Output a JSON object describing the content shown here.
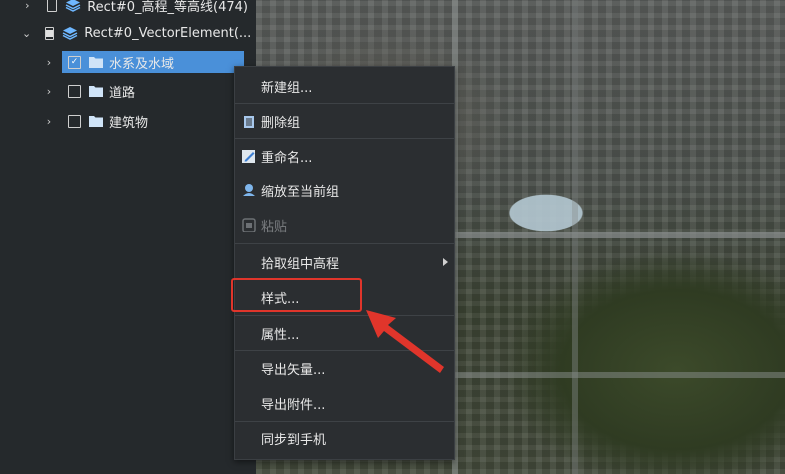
{
  "tree": {
    "items": [
      {
        "label": "Rect#0_高程_等高线(474)",
        "expanded": false,
        "checked": "unchecked",
        "icon": "layers-icon"
      },
      {
        "label": "Rect#0_VectorElement(...",
        "expanded": true,
        "checked": "partial",
        "icon": "layers-icon"
      },
      {
        "label": "水系及水域",
        "expanded": false,
        "checked": "checked",
        "icon": "folder-icon",
        "selected": true
      },
      {
        "label": "道路",
        "expanded": false,
        "checked": "unchecked",
        "icon": "folder-icon"
      },
      {
        "label": "建筑物",
        "expanded": false,
        "checked": "unchecked",
        "icon": "folder-icon"
      }
    ]
  },
  "context_menu": {
    "items": [
      {
        "label": "新建组...",
        "icon": "",
        "disabled": false
      },
      {
        "label": "删除组",
        "icon": "trash-icon",
        "disabled": false
      },
      {
        "label": "重命名...",
        "icon": "pencil-icon",
        "disabled": false
      },
      {
        "label": "缩放至当前组",
        "icon": "location-pin-icon",
        "disabled": false
      },
      {
        "label": "粘贴",
        "icon": "paste-icon",
        "disabled": true
      },
      {
        "label": "拾取组中高程",
        "icon": "",
        "disabled": false,
        "submenu": true
      },
      {
        "label": "样式...",
        "icon": "",
        "disabled": false,
        "highlighted": true
      },
      {
        "label": "属性...",
        "icon": "",
        "disabled": false
      },
      {
        "label": "导出矢量...",
        "icon": "",
        "disabled": false
      },
      {
        "label": "导出附件...",
        "icon": "",
        "disabled": false
      },
      {
        "label": "同步到手机",
        "icon": "",
        "disabled": false
      }
    ]
  },
  "colors": {
    "selection": "#4a90d9",
    "annotation_red": "#e0352b",
    "menu_bg": "#2b2e31",
    "panel_bg": "#25292c"
  }
}
